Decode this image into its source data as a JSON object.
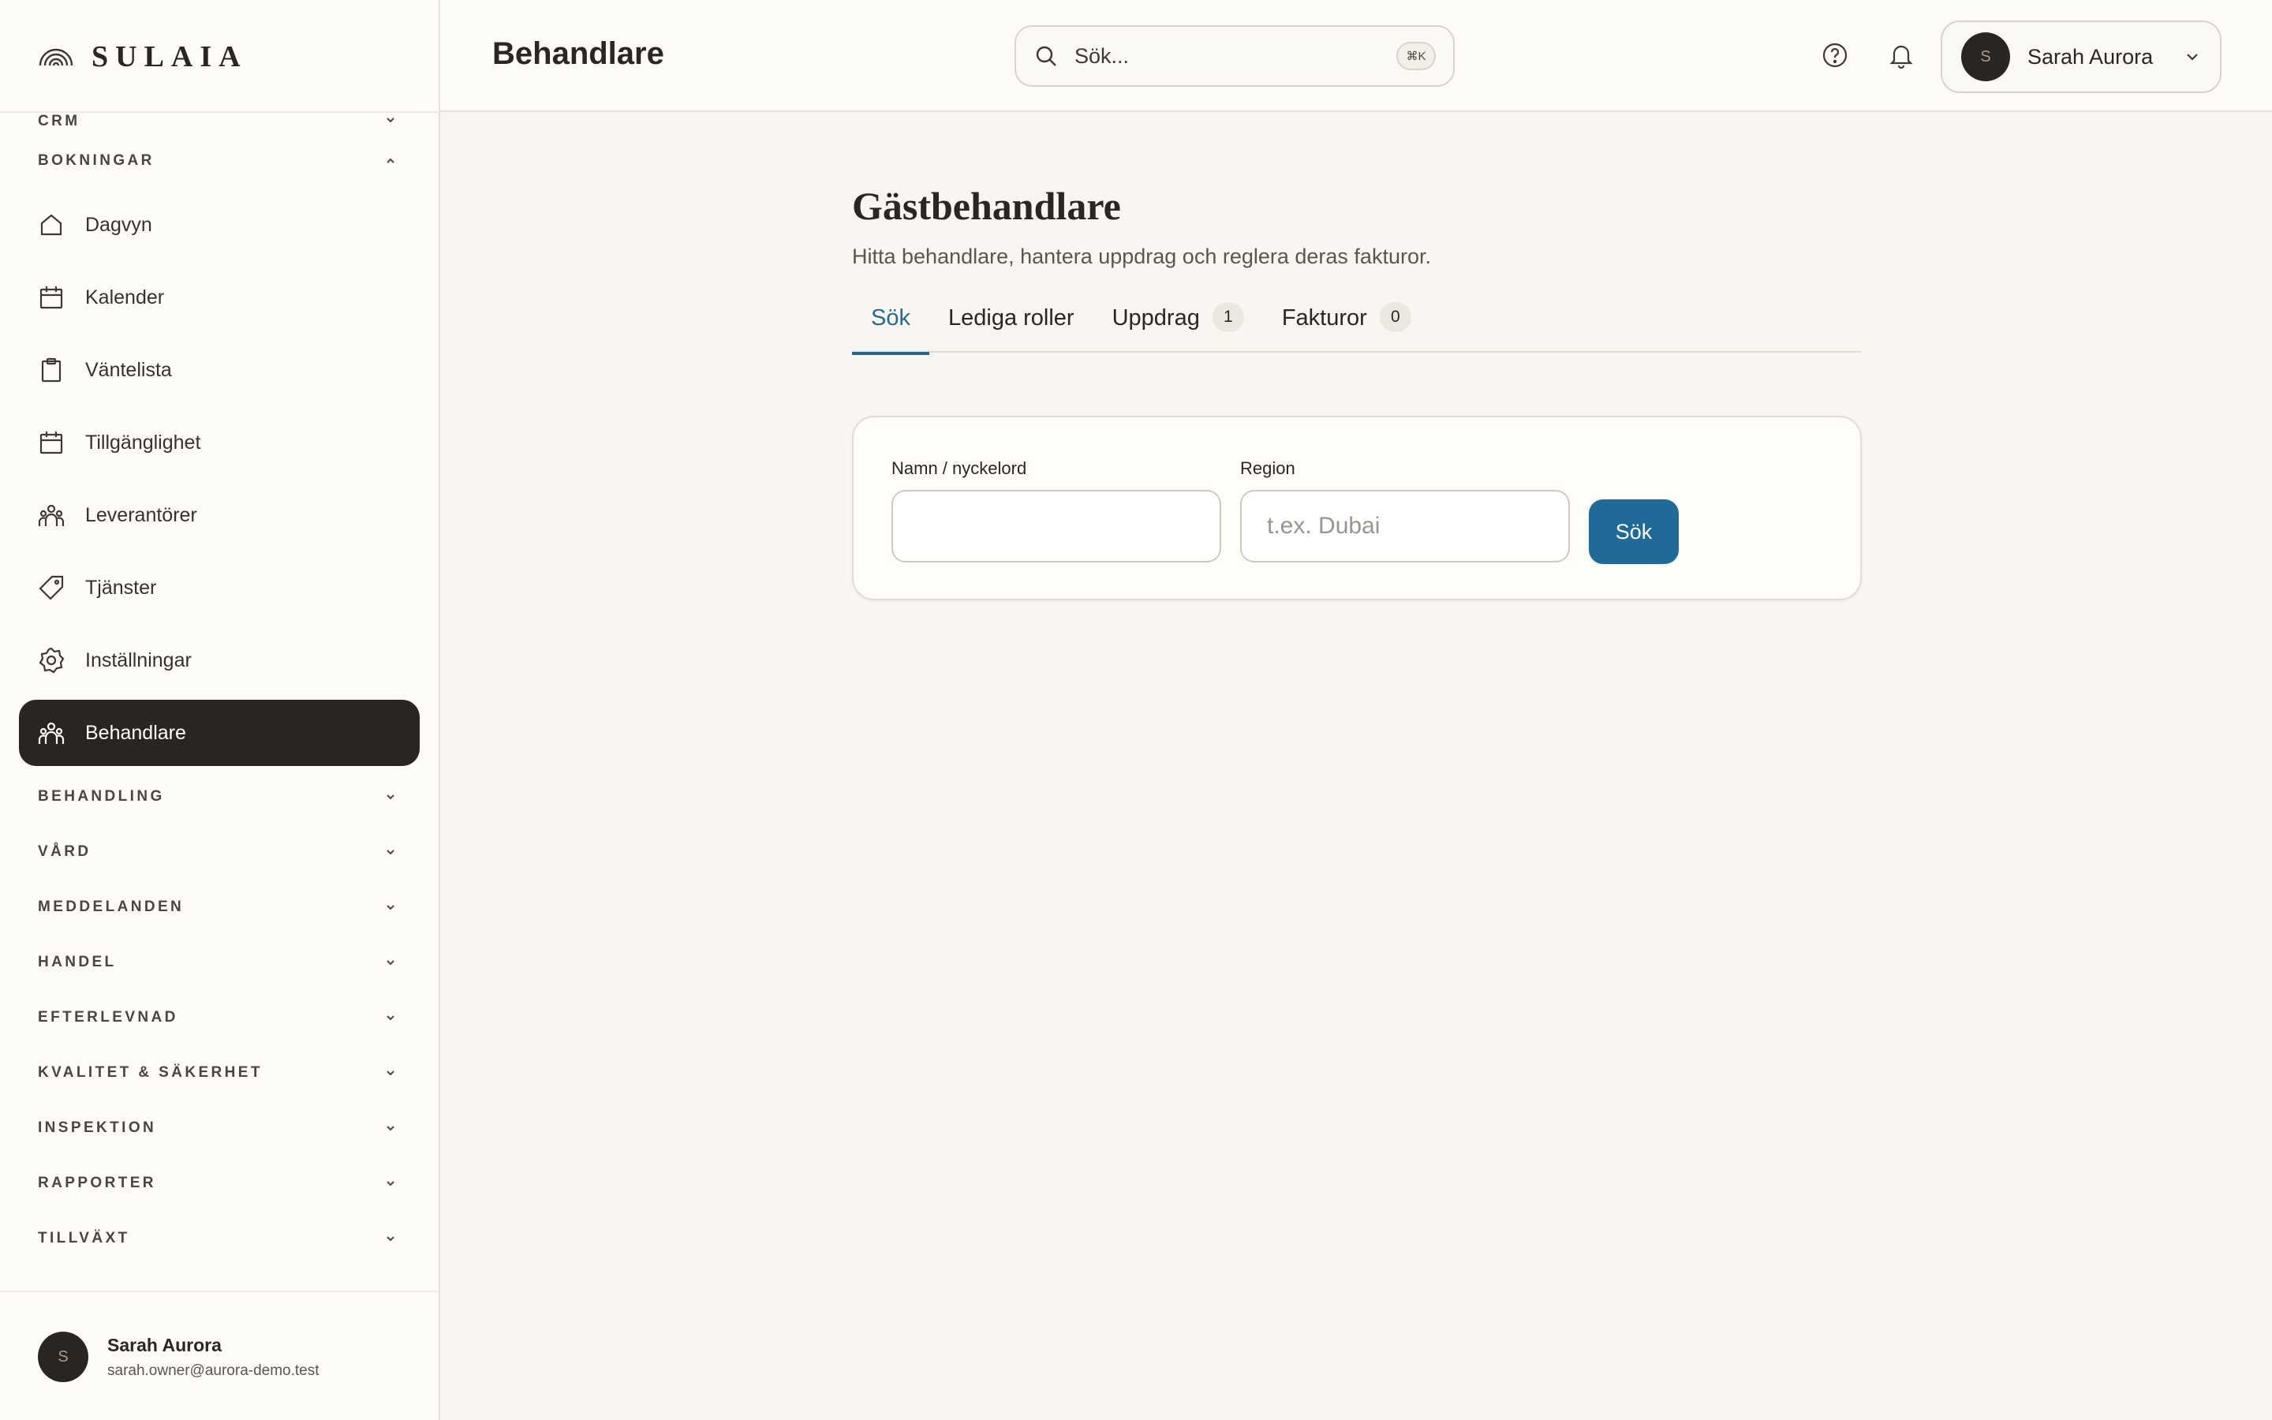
{
  "brand": {
    "name": "SULAIA"
  },
  "header": {
    "title": "Behandlare",
    "search_placeholder": "Sök...",
    "search_shortcut": "⌘K",
    "user_name": "Sarah Aurora",
    "user_initial": "S"
  },
  "sidebar": {
    "sections_top": [
      {
        "label": "CRM"
      },
      {
        "label": "BOKNINGAR"
      }
    ],
    "items": [
      {
        "label": "Dagvyn",
        "icon": "home-icon"
      },
      {
        "label": "Kalender",
        "icon": "calendar-icon"
      },
      {
        "label": "Väntelista",
        "icon": "clipboard-icon"
      },
      {
        "label": "Tillgänglighet",
        "icon": "calendar-icon"
      },
      {
        "label": "Leverantörer",
        "icon": "users-icon"
      },
      {
        "label": "Tjänster",
        "icon": "tag-icon"
      },
      {
        "label": "Inställningar",
        "icon": "gear-icon"
      },
      {
        "label": "Behandlare",
        "icon": "users-icon",
        "active": true
      }
    ],
    "sections_bottom": [
      {
        "label": "BEHANDLING"
      },
      {
        "label": "VÅRD"
      },
      {
        "label": "MEDDELANDEN"
      },
      {
        "label": "HANDEL"
      },
      {
        "label": "EFTERLEVNAD"
      },
      {
        "label": "KVALITET & SÄKERHET"
      },
      {
        "label": "INSPEKTION"
      },
      {
        "label": "RAPPORTER"
      },
      {
        "label": "TILLVÄXT"
      }
    ],
    "user": {
      "name": "Sarah Aurora",
      "email": "sarah.owner@aurora-demo.test",
      "initial": "S"
    }
  },
  "main": {
    "title": "Gästbehandlare",
    "subtitle": "Hitta behandlare, hantera uppdrag och reglera deras fakturor.",
    "tabs": [
      {
        "label": "Sök",
        "active": true
      },
      {
        "label": "Lediga roller"
      },
      {
        "label": "Uppdrag",
        "count": "1"
      },
      {
        "label": "Fakturor",
        "count": "0"
      }
    ],
    "form": {
      "name_label": "Namn / nyckelord",
      "name_value": "",
      "region_label": "Region",
      "region_placeholder": "t.ex. Dubai",
      "submit_label": "Sök"
    }
  },
  "colors": {
    "accent": "#1f6a99",
    "active_nav_bg": "#2b2521",
    "background": "#f9f6f1"
  }
}
